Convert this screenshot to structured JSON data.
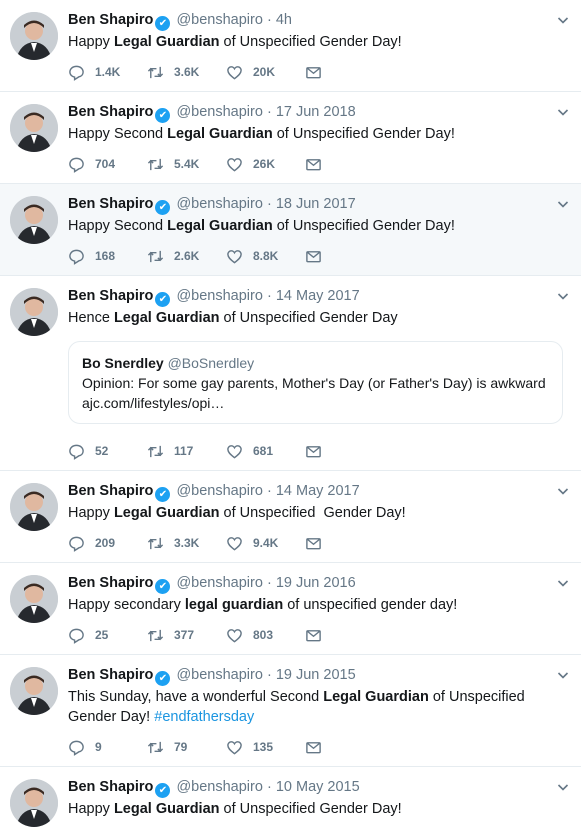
{
  "author": {
    "name": "Ben Shapiro",
    "handle": "@benshapiro",
    "verified_glyph": "✔",
    "avatar_icon": "avatar-photo"
  },
  "dot": "·",
  "tweets": [
    {
      "time": "4h",
      "t1": "Happy ",
      "b1": "Legal Guardian",
      "t2": " of Unspecified Gender Day!",
      "replies": "1.4K",
      "retweets": "3.6K",
      "likes": "20K"
    },
    {
      "time": "17 Jun 2018",
      "t1": "Happy Second ",
      "b1": "Legal Guardian",
      "t2": " of Unspecified Gender Day!",
      "replies": "704",
      "retweets": "5.4K",
      "likes": "26K"
    },
    {
      "time": "18 Jun 2017",
      "t1": "Happy Second ",
      "b1": "Legal Guardian",
      "t2": " of Unspecified Gender Day!",
      "replies": "168",
      "retweets": "2.6K",
      "likes": "8.8K"
    },
    {
      "time": "14 May 2017",
      "t1": "Hence ",
      "b1": "Legal Guardian",
      "t2": " of Unspecified Gender Day",
      "replies": "52",
      "retweets": "117",
      "likes": "681",
      "quote": {
        "name": "Bo Snerdley",
        "handle": "@BoSnerdley",
        "text": "Opinion: For some gay parents, Mother's Day (or Father's Day) is awkward",
        "link": "ajc.com/lifestyles/opi…"
      }
    },
    {
      "time": "14 May 2017",
      "t1": "Happy ",
      "b1": "Legal Guardian",
      "t2": " of Unspecified  Gender Day!",
      "replies": "209",
      "retweets": "3.3K",
      "likes": "9.4K"
    },
    {
      "time": "19 Jun 2016",
      "t1": "Happy secondary ",
      "b1": "legal guardian",
      "t2": " of unspecified gender day!",
      "replies": "25",
      "retweets": "377",
      "likes": "803"
    },
    {
      "time": "19 Jun 2015",
      "t1": "This Sunday, have a wonderful Second ",
      "b1": "Legal Guardian",
      "t2": " of Unspecified Gender Day! ",
      "hashtag": "#endfathersday",
      "replies": "9",
      "retweets": "79",
      "likes": "135"
    },
    {
      "time": "10 May 2015",
      "t1": "Happy ",
      "b1": "Legal Guardian",
      "t2": " of Unspecified Gender Day!"
    }
  ],
  "colors": {
    "accent": "#1da1f2",
    "muted": "#657786",
    "highlight_bg": "#f5f8fa"
  }
}
